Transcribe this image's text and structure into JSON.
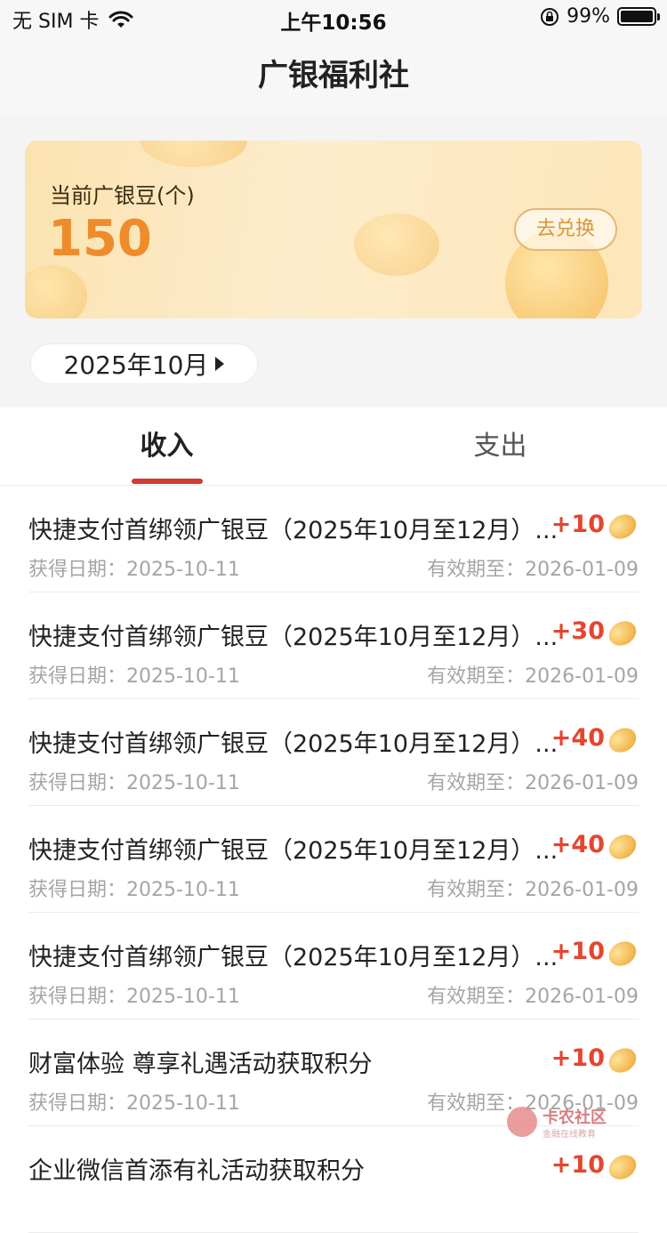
{
  "status_bar": {
    "carrier": "无 SIM 卡",
    "time": "上午10:56",
    "battery": "99%"
  },
  "nav": {
    "title": "广银福利社"
  },
  "card": {
    "label": "当前广银豆(个)",
    "value": "150",
    "exchange_label": "去兑换"
  },
  "month_picker": {
    "label": "2025年10月"
  },
  "tabs": [
    {
      "label": "收入",
      "active": true
    },
    {
      "label": "支出",
      "active": false
    }
  ],
  "records": [
    {
      "title": "快捷支付首绑领广银豆（2025年10月至12月）...",
      "points": "+10",
      "date": "获得日期：2025-10-11",
      "expiry": "有效期至：2026-01-09"
    },
    {
      "title": "快捷支付首绑领广银豆（2025年10月至12月）...",
      "points": "+30",
      "date": "获得日期：2025-10-11",
      "expiry": "有效期至：2026-01-09"
    },
    {
      "title": "快捷支付首绑领广银豆（2025年10月至12月）...",
      "points": "+40",
      "date": "获得日期：2025-10-11",
      "expiry": "有效期至：2026-01-09"
    },
    {
      "title": "快捷支付首绑领广银豆（2025年10月至12月）...",
      "points": "+40",
      "date": "获得日期：2025-10-11",
      "expiry": "有效期至：2026-01-09"
    },
    {
      "title": "快捷支付首绑领广银豆（2025年10月至12月）...",
      "points": "+10",
      "date": "获得日期：2025-10-11",
      "expiry": "有效期至：2026-01-09"
    },
    {
      "title": "财富体验 尊享礼遇活动获取积分",
      "points": "+10",
      "date": "获得日期：2025-10-11",
      "expiry": "有效期至：2026-01-09"
    },
    {
      "title": "企业微信首添有礼活动获取积分",
      "points": "+10",
      "date": "",
      "expiry": ""
    }
  ],
  "watermark": {
    "name": "卡农社区",
    "tagline": "金融在线教育"
  },
  "colors": {
    "accent_red": "#d23a33",
    "points_red": "#e5452f",
    "bean_orange": "#ee8b2a"
  },
  "icons": {
    "wifi": "wifi-icon",
    "lock": "rotation-lock-icon",
    "battery": "battery-icon",
    "bean": "bean-icon",
    "caret": "caret-right-icon"
  }
}
